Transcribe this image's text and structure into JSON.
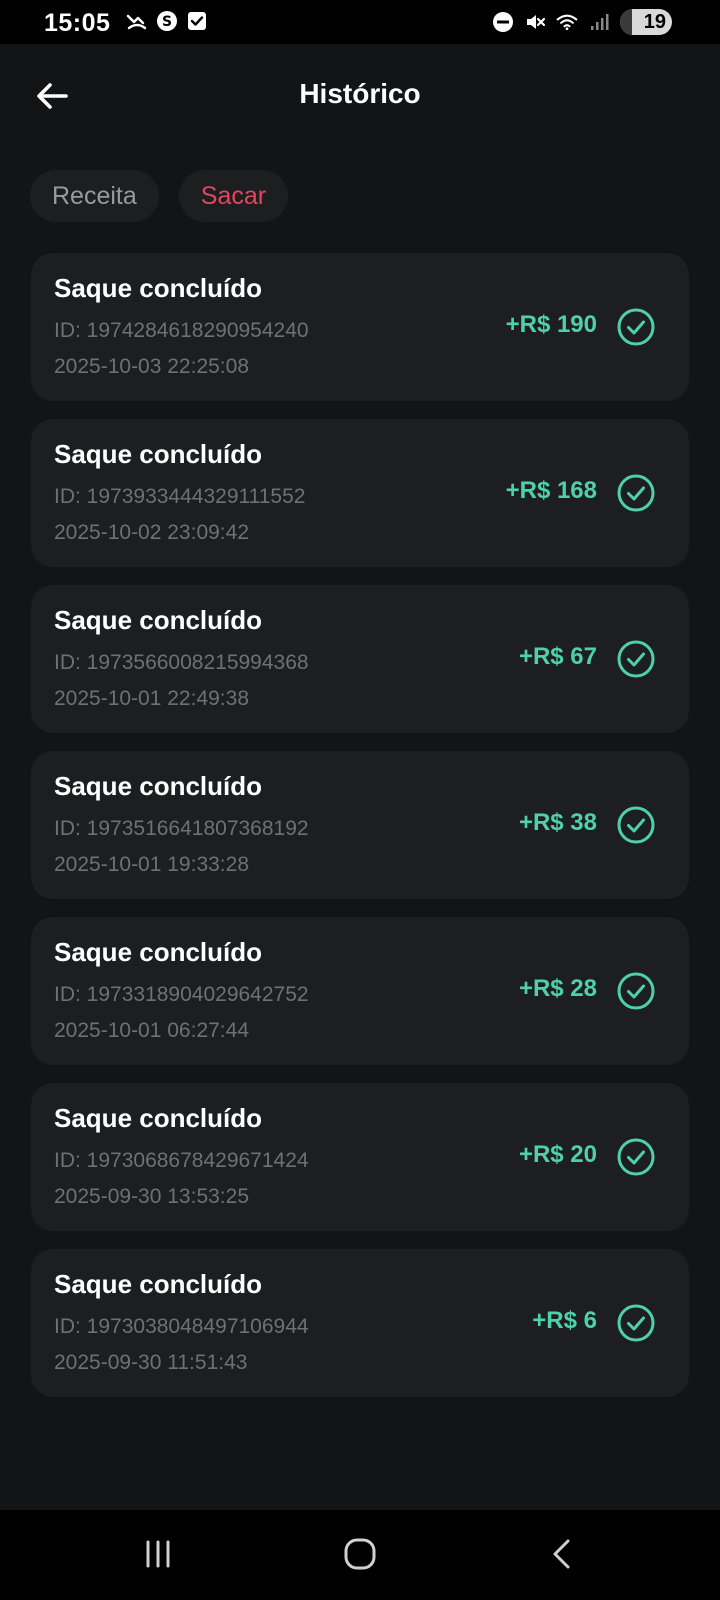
{
  "status_bar": {
    "time": "15:05",
    "battery": "19"
  },
  "header": {
    "title": "Histórico"
  },
  "tabs": [
    {
      "label": "Receita",
      "active": false
    },
    {
      "label": "Sacar",
      "active": true
    }
  ],
  "colors": {
    "accent_active_tab": "#e0485f",
    "amount_green": "#4fd1a7",
    "card_background": "#1c1e1f"
  },
  "history": [
    {
      "title": "Saque concluído",
      "id": "ID: 1974284618290954240",
      "date": "2025-10-03 22:25:08",
      "amount": "+R$ 190"
    },
    {
      "title": "Saque concluído",
      "id": "ID: 1973933444329111552",
      "date": "2025-10-02 23:09:42",
      "amount": "+R$ 168"
    },
    {
      "title": "Saque concluído",
      "id": "ID: 1973566008215994368",
      "date": "2025-10-01 22:49:38",
      "amount": "+R$ 67"
    },
    {
      "title": "Saque concluído",
      "id": "ID: 1973516641807368192",
      "date": "2025-10-01 19:33:28",
      "amount": "+R$ 38"
    },
    {
      "title": "Saque concluído",
      "id": "ID: 1973318904029642752",
      "date": "2025-10-01 06:27:44",
      "amount": "+R$ 28"
    },
    {
      "title": "Saque concluído",
      "id": "ID: 1973068678429671424",
      "date": "2025-09-30 13:53:25",
      "amount": "+R$ 20"
    },
    {
      "title": "Saque concluído",
      "id": "ID: 1973038048497106944",
      "date": "2025-09-30 11:51:43",
      "amount": "+R$ 6"
    }
  ],
  "icons": {
    "back": "arrow-left-icon",
    "status_check": "check-circle-icon",
    "nav_recents": "recents-icon",
    "nav_home": "home-icon",
    "nav_back": "back-chevron-icon"
  }
}
